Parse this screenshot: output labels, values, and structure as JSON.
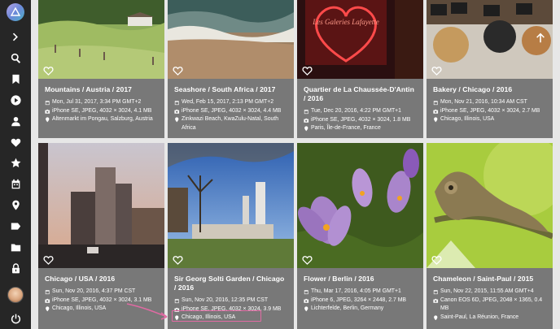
{
  "sidebar": {
    "logo_icon": "triangle-logo-icon",
    "items": [
      {
        "name": "expand",
        "icon": "chevron-right-icon"
      },
      {
        "name": "search",
        "icon": "search-icon"
      },
      {
        "name": "albums",
        "icon": "bookmark-icon"
      },
      {
        "name": "videos",
        "icon": "play-circle-icon"
      },
      {
        "name": "people",
        "icon": "person-icon"
      },
      {
        "name": "favorites",
        "icon": "heart-icon"
      },
      {
        "name": "moments",
        "icon": "star-icon"
      },
      {
        "name": "calendar",
        "icon": "calendar-icon"
      },
      {
        "name": "places",
        "icon": "map-pin-icon"
      },
      {
        "name": "labels",
        "icon": "label-icon"
      },
      {
        "name": "folders",
        "icon": "folder-icon"
      },
      {
        "name": "private",
        "icon": "lock-icon"
      }
    ],
    "power_icon": "power-icon"
  },
  "photos": [
    {
      "title": "Mountains / Austria / 2017",
      "date": "Mon, Jul 31, 2017, 3:34 PM GMT+2",
      "camera": "iPhone SE, JPEG, 4032 × 3024, 4.1 MB",
      "location": "Altenmarkt im Pongau, Salzburg, Austria"
    },
    {
      "title": "Seashore / South Africa / 2017",
      "date": "Wed, Feb 15, 2017, 2:13 PM GMT+2",
      "camera": "iPhone SE, JPEG, 4032 × 3024, 4.4 MB",
      "location": "Zinkwazi Beach, KwaZulu-Natal, South Africa"
    },
    {
      "title": "Quartier de La Chaussée-D'Antin / 2016",
      "date": "Tue, Dec 20, 2016, 4:22 PM GMT+1",
      "camera": "iPhone SE, JPEG, 4032 × 3024, 1.8 MB",
      "location": "Paris, Île-de-France, France"
    },
    {
      "title": "Bakery / Chicago / 2016",
      "date": "Mon, Nov 21, 2016, 10:34 AM CST",
      "camera": "iPhone SE, JPEG, 4032 × 3024, 2.7 MB",
      "location": "Chicago, Illinois, USA"
    },
    {
      "title": "Chicago / USA / 2016",
      "date": "Sun, Nov 20, 2016, 4:37 PM CST",
      "camera": "iPhone SE, JPEG, 4032 × 3024, 3.1 MB",
      "location": "Chicago, Illinois, USA"
    },
    {
      "title": "Sir Georg Solti Garden / Chicago / 2016",
      "date": "Sun, Nov 20, 2016, 12:35 PM CST",
      "camera": "iPhone SE, JPEG, 4032 × 3024, 3.9 MB",
      "location": "Chicago, Illinois, USA"
    },
    {
      "title": "Flower / Berlin / 2016",
      "date": "Thu, Mar 17, 2016, 4:05 PM GMT+1",
      "camera": "iPhone 6, JPEG, 3264 × 2448, 2.7 MB",
      "location": "Lichterfelde, Berlin, Germany"
    },
    {
      "title": "Chameleon / Saint-Paul / 2015",
      "date": "Sun, Nov 22, 2015, 11:55 AM GMT+4",
      "camera": "Canon EOS 6D, JPEG, 2048 × 1365, 0.4 MB",
      "location": "Saint-Paul, La Réunion, France"
    }
  ],
  "neon_sign_text": "Les Galeries Lafayette",
  "annotation_color": "#e06aa3"
}
